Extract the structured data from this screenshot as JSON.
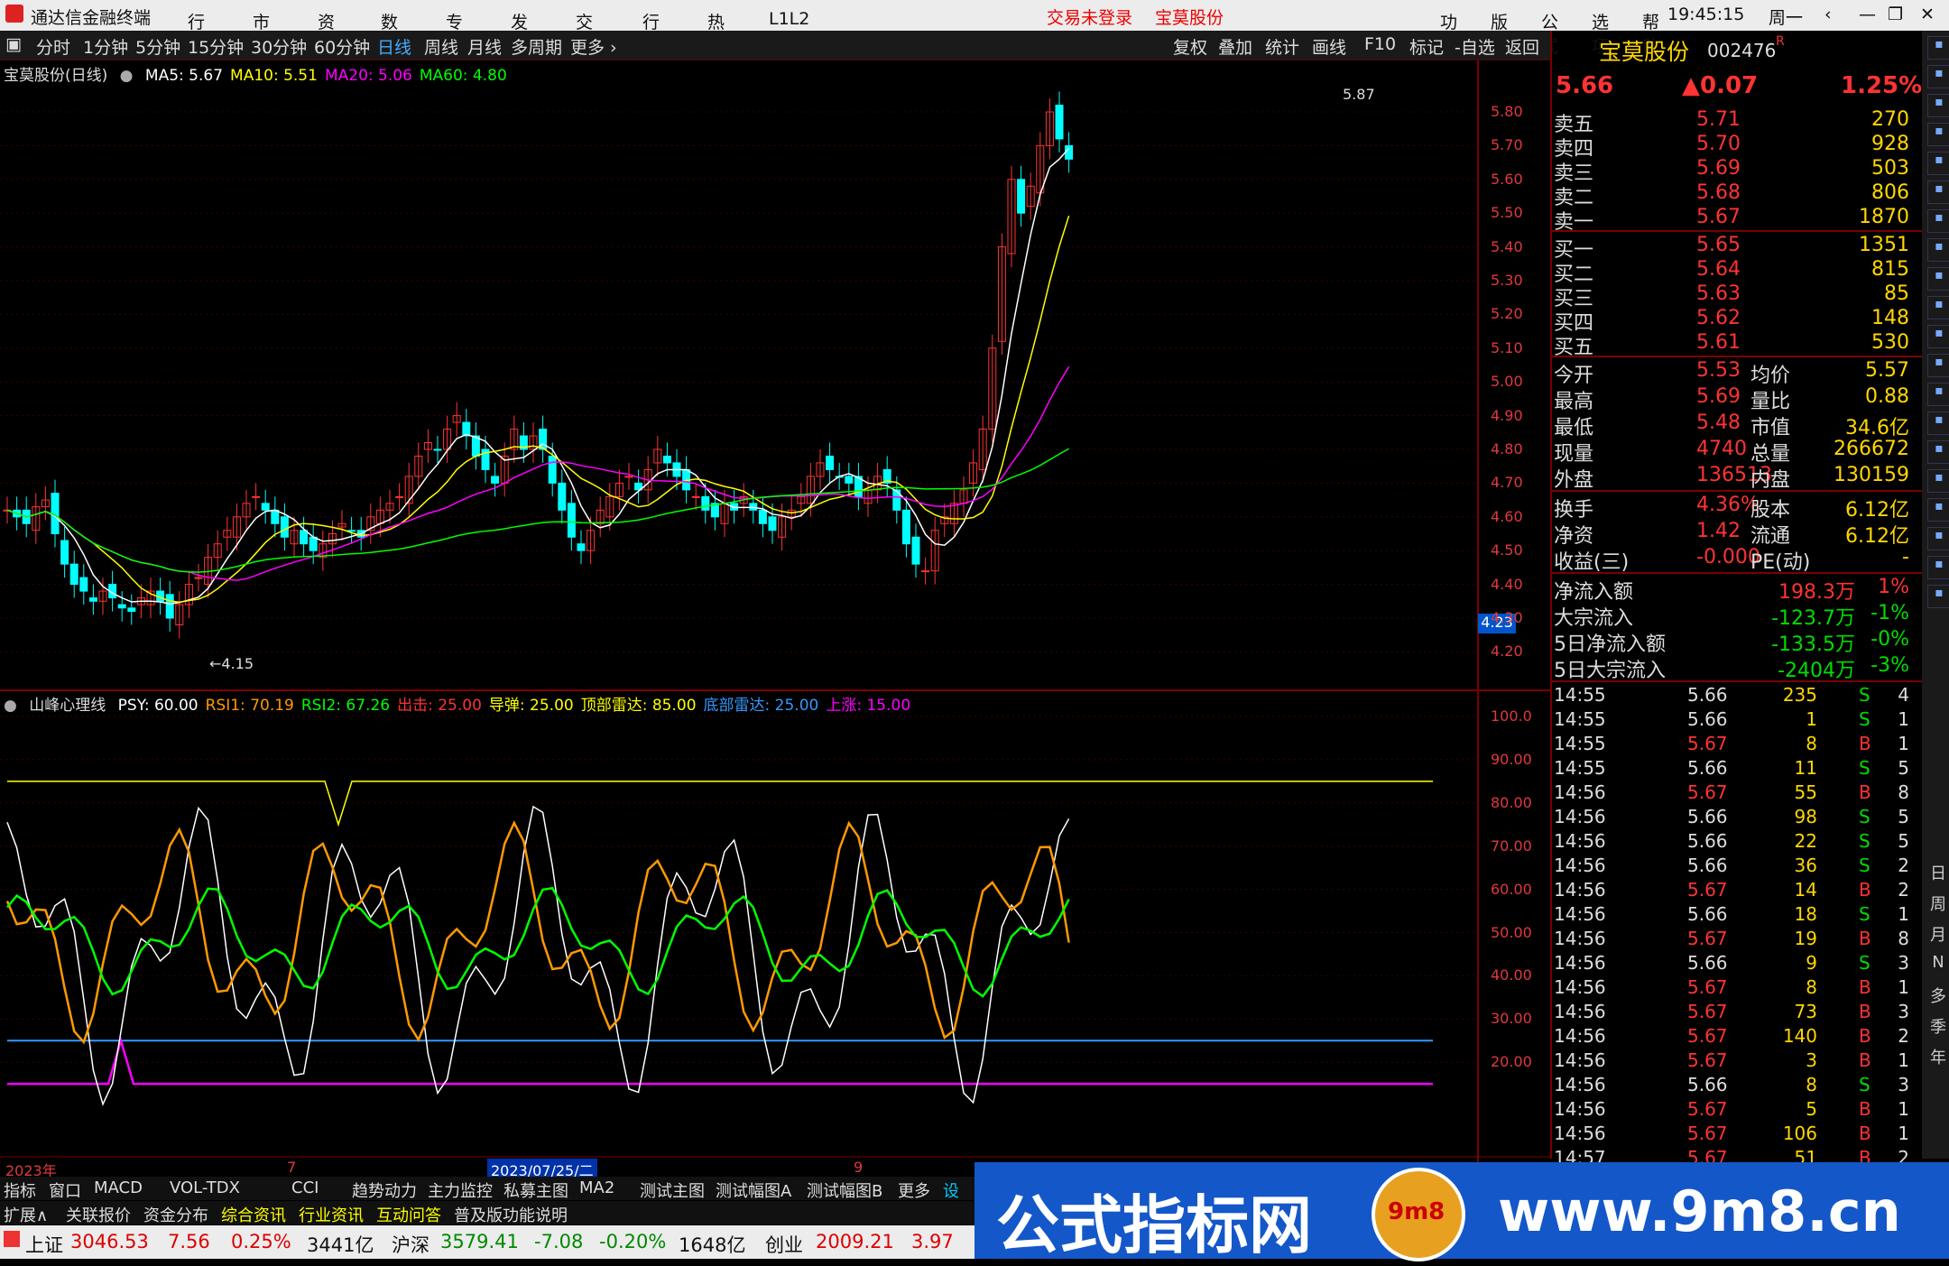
{
  "app": {
    "title": "通达信金融终端",
    "menus": [
      "行情",
      "市场",
      "资讯",
      "数据",
      "专题",
      "发现",
      "交易",
      "行业",
      "热点",
      "L1L2"
    ],
    "login": "交易未登录",
    "stock_tab": "宝莫股份",
    "right_menus": [
      "功能",
      "版面",
      "公式",
      "选项",
      "帮助"
    ],
    "time": "19:45:15",
    "weekday": "周一"
  },
  "toolbar": {
    "periods": [
      "分时",
      "1分钟",
      "5分钟",
      "15分钟",
      "30分钟",
      "60分钟",
      "日线",
      "周线",
      "月线",
      "多周期",
      "更多"
    ],
    "active": "日线",
    "tools": [
      "复权",
      "叠加",
      "统计",
      "画线",
      "F10",
      "标记",
      "-自选",
      "返回"
    ]
  },
  "main_chart": {
    "title": "宝莫股份(日线)",
    "ma": [
      {
        "label": "MA5: 5.67",
        "color": "#ffffff"
      },
      {
        "label": "MA10: 5.51",
        "color": "#ffff00"
      },
      {
        "label": "MA20: 5.06",
        "color": "#ff00ff"
      },
      {
        "label": "MA60: 4.80",
        "color": "#00ff00"
      }
    ],
    "y_ticks": [
      "5.80",
      "5.70",
      "5.60",
      "5.50",
      "5.40",
      "5.30",
      "5.20",
      "5.10",
      "5.00",
      "4.90",
      "4.80",
      "4.70",
      "4.60",
      "4.50",
      "4.40",
      "4.30",
      "4.20"
    ],
    "high_label": "5.87",
    "low_label": "4.15",
    "cursor_price": "4.23"
  },
  "sub_chart": {
    "title": "山峰心理线",
    "params": [
      {
        "label": "PSY: 60.00",
        "color": "#ffffff"
      },
      {
        "label": "RSI1: 70.19",
        "color": "#ff9900"
      },
      {
        "label": "RSI2: 67.26",
        "color": "#00ff00"
      },
      {
        "label": "出击: 25.00",
        "color": "#ff3333"
      },
      {
        "label": "导弹: 25.00",
        "color": "#ffff00"
      },
      {
        "label": "顶部雷达: 85.00",
        "color": "#ffff00"
      },
      {
        "label": "底部雷达: 25.00",
        "color": "#3399ff"
      },
      {
        "label": "上涨: 15.00",
        "color": "#ff00ff"
      }
    ],
    "y_ticks": [
      "100.0",
      "90.00",
      "80.00",
      "70.00",
      "60.00",
      "50.00",
      "40.00",
      "30.00",
      "20.00"
    ]
  },
  "time_axis": {
    "year": "2023年",
    "m1": "7",
    "cursor_date": "2023/07/25/二",
    "m2": "9"
  },
  "quote": {
    "name": "宝莫股份",
    "code": "002476",
    "r": "R",
    "price": "5.66",
    "change": "▲0.07",
    "pct": "1.25%",
    "asks": [
      [
        "卖五",
        "5.71",
        "270"
      ],
      [
        "卖四",
        "5.70",
        "928"
      ],
      [
        "卖三",
        "5.69",
        "503"
      ],
      [
        "卖二",
        "5.68",
        "806"
      ],
      [
        "卖一",
        "5.67",
        "1870"
      ]
    ],
    "bids": [
      [
        "买一",
        "5.65",
        "1351"
      ],
      [
        "买二",
        "5.64",
        "815"
      ],
      [
        "买三",
        "5.63",
        "85"
      ],
      [
        "买四",
        "5.62",
        "148"
      ],
      [
        "买五",
        "5.61",
        "530"
      ]
    ],
    "stats": [
      [
        "今开",
        "5.53",
        "均价",
        "5.57"
      ],
      [
        "最高",
        "5.69",
        "量比",
        "0.88"
      ],
      [
        "最低",
        "5.48",
        "市值",
        "34.6亿"
      ],
      [
        "现量",
        "4740",
        "总量",
        "266672"
      ],
      [
        "外盘",
        "136513",
        "内盘",
        "130159"
      ]
    ],
    "stats2": [
      [
        "换手",
        "4.36%",
        "股本",
        "6.12亿"
      ],
      [
        "净资",
        "1.42",
        "流通",
        "6.12亿"
      ],
      [
        "收益(三)",
        "-0.000",
        "PE(动)",
        "-"
      ]
    ],
    "flows": [
      [
        "净流入额",
        "198.3万",
        "1%"
      ],
      [
        "大宗流入",
        "-123.7万",
        "-1%"
      ],
      [
        "5日净流入额",
        "-133.5万",
        "-0%"
      ],
      [
        "5日大宗流入",
        "-2404万",
        "-3%"
      ]
    ],
    "ticks": [
      [
        "14:55",
        "5.66",
        "235",
        "S",
        "4"
      ],
      [
        "14:55",
        "5.66",
        "1",
        "S",
        "1"
      ],
      [
        "14:55",
        "5.67",
        "8",
        "B",
        "1"
      ],
      [
        "14:55",
        "5.66",
        "11",
        "S",
        "5"
      ],
      [
        "14:56",
        "5.67",
        "55",
        "B",
        "8"
      ],
      [
        "14:56",
        "5.66",
        "98",
        "S",
        "5"
      ],
      [
        "14:56",
        "5.66",
        "22",
        "S",
        "5"
      ],
      [
        "14:56",
        "5.66",
        "36",
        "S",
        "2"
      ],
      [
        "14:56",
        "5.67",
        "14",
        "B",
        "2"
      ],
      [
        "14:56",
        "5.66",
        "18",
        "S",
        "1"
      ],
      [
        "14:56",
        "5.67",
        "19",
        "B",
        "8"
      ],
      [
        "14:56",
        "5.66",
        "9",
        "S",
        "3"
      ],
      [
        "14:56",
        "5.67",
        "8",
        "B",
        "1"
      ],
      [
        "14:56",
        "5.67",
        "73",
        "B",
        "3"
      ],
      [
        "14:56",
        "5.67",
        "140",
        "B",
        "2"
      ],
      [
        "14:56",
        "5.67",
        "3",
        "B",
        "1"
      ],
      [
        "14:56",
        "5.66",
        "8",
        "S",
        "3"
      ],
      [
        "14:56",
        "5.67",
        "5",
        "B",
        "1"
      ],
      [
        "14:56",
        "5.67",
        "106",
        "B",
        "1"
      ],
      [
        "14:57",
        "5.67",
        "51",
        "B",
        "2"
      ]
    ]
  },
  "side_icons": [
    "日",
    "周",
    "月",
    "N",
    "多",
    "季",
    "年"
  ],
  "bottom_tabs1": [
    "指标",
    "窗口",
    "MACD",
    "VOL-TDX",
    "CCI",
    "趋势动力",
    "主力监控",
    "私募主图",
    "MA2",
    "测试主图",
    "测试幅图A",
    "测试幅图B",
    "更多",
    "设置"
  ],
  "bottom_tabs2": [
    "扩展∧",
    "关联报价",
    "资金分布",
    "综合资讯",
    "行业资讯",
    "互动问答",
    "普及版功能说明"
  ],
  "status": {
    "sh_label": "上证",
    "sh": "3046.53",
    "sh_chg": "7.56",
    "sh_pct": "0.25%",
    "sh_amt": "3441亿",
    "hs_label": "沪深",
    "hs": "3579.41",
    "hs_chg": "-7.08",
    "hs_pct": "-0.20%",
    "hs_amt": "1648亿",
    "cy_label": "创业",
    "cy": "2009.21",
    "cy_chg": "3.97"
  },
  "banner": {
    "text": "公式指标网",
    "url": "www.9m8.cn",
    "logo": "9m8"
  }
}
